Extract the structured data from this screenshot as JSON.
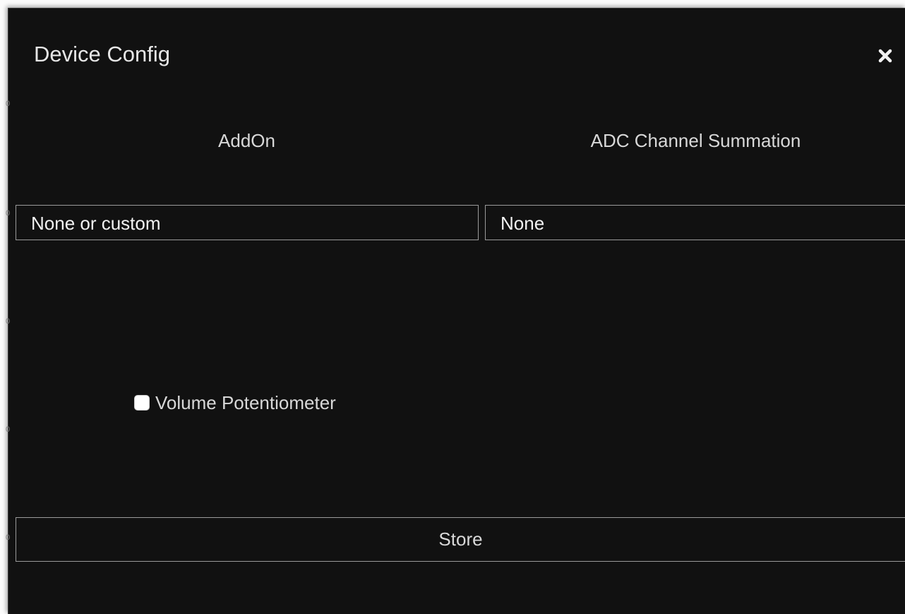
{
  "dialog": {
    "title": "Device Config",
    "close_icon": "close-icon"
  },
  "fields": {
    "addon": {
      "label": "AddOn",
      "value": "None or custom"
    },
    "adc_summation": {
      "label": "ADC Channel Summation",
      "value": "None"
    }
  },
  "volume_potentiometer": {
    "label": "Volume Potentiometer",
    "checked": false
  },
  "store": {
    "label": "Store"
  },
  "colors": {
    "dialog_background": "#111111",
    "text": "#d8d8d8",
    "border": "#9a9a9a"
  }
}
